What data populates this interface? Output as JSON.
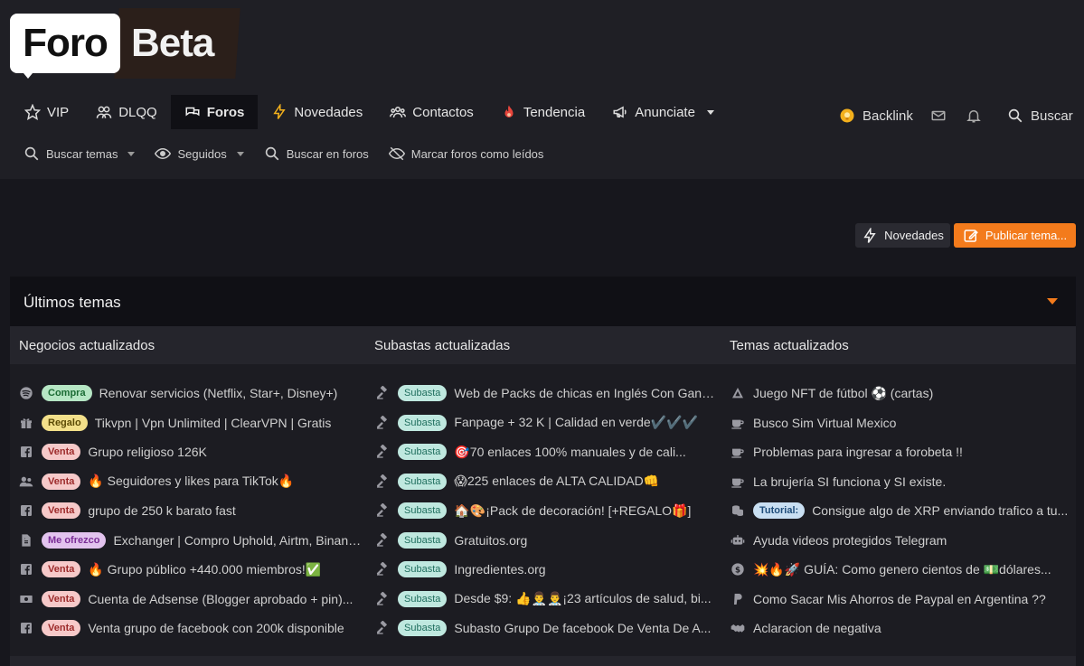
{
  "logo": {
    "part1": "Foro",
    "part2": "Beta"
  },
  "nav": {
    "vip": "VIP",
    "dlqq": "DLQQ",
    "foros": "Foros",
    "novedades": "Novedades",
    "contactos": "Contactos",
    "tendencia": "Tendencia",
    "anunciate": "Anunciate",
    "backlink": "Backlink",
    "buscar": "Buscar"
  },
  "subnav": {
    "buscar_temas": "Buscar temas",
    "seguidos": "Seguidos",
    "buscar_en_foros": "Buscar en foros",
    "marcar_leidos": "Marcar foros como leídos"
  },
  "actions": {
    "novedades": "Novedades",
    "publicar": "Publicar tema..."
  },
  "accent_color": "#f37b1c",
  "latest": {
    "title": "Últimos temas",
    "columns": {
      "negocios": "Negocios actualizados",
      "subastas": "Subastas actualizadas",
      "temas": "Temas actualizados"
    },
    "negocios": [
      {
        "icon": "spotify-icon",
        "badge": "Compra",
        "title": "Renovar servicios (Netflix, Star+, Disney+)"
      },
      {
        "icon": "gift-icon",
        "badge": "Regalo",
        "title": "Tikvpn | Vpn Unlimited | ClearVPN | Gratis"
      },
      {
        "icon": "facebook-icon",
        "badge": "Venta",
        "title": "Grupo religioso 126K"
      },
      {
        "icon": "users-icon",
        "badge": "Venta",
        "title": "🔥 Seguidores y likes para TikTok🔥"
      },
      {
        "icon": "facebook-icon",
        "badge": "Venta",
        "title": "grupo de 250 k barato fast"
      },
      {
        "icon": "document-icon",
        "badge": "Me ofrezco",
        "title": "Exchanger | Compro Uphold, Airtm, Binance..."
      },
      {
        "icon": "facebook-icon",
        "badge": "Venta",
        "title": "🔥 Grupo público +440.000 miembros!✅"
      },
      {
        "icon": "money-icon",
        "badge": "Venta",
        "title": "Cuenta de Adsense (Blogger aprobado + pin)..."
      },
      {
        "icon": "facebook-icon",
        "badge": "Venta",
        "title": "Venta grupo de facebook con 200k disponible"
      }
    ],
    "subastas": [
      {
        "badge": "Subasta",
        "title": "Web de Packs de chicas en Inglés Con Gana..."
      },
      {
        "badge": "Subasta",
        "title": "Fanpage + 32 K | Calidad en verde✔️✔️✔️"
      },
      {
        "badge": "Subasta",
        "title": "🎯70 enlaces 100% manuales y de cali..."
      },
      {
        "badge": "Subasta",
        "title": "😱225 enlaces de ALTA CALIDAD👊"
      },
      {
        "badge": "Subasta",
        "title": "🏠🎨¡Pack de decoración! [+REGALO🎁]"
      },
      {
        "badge": "Subasta",
        "title": "Gratuitos.org"
      },
      {
        "badge": "Subasta",
        "title": "Ingredientes.org"
      },
      {
        "badge": "Subasta",
        "title": "Desde $9: 👍👨‍⚕️👨‍⚕️¡23 artículos de salud, bi..."
      },
      {
        "badge": "Subasta",
        "title": "Subasto Grupo De facebook De Venta De A..."
      }
    ],
    "temas": [
      {
        "icon": "nft-icon",
        "badge": "",
        "title": "Juego NFT de fútbol ⚽ (cartas)"
      },
      {
        "icon": "coffee-icon",
        "badge": "",
        "title": "Busco Sim Virtual Mexico"
      },
      {
        "icon": "coffee-icon",
        "badge": "",
        "title": "Problemas para ingresar a forobeta !!"
      },
      {
        "icon": "coffee-icon",
        "badge": "",
        "title": "La brujería SI funciona y SI existe."
      },
      {
        "icon": "coins-icon",
        "badge": "Tutorial:",
        "title": "Consigue algo de XRP enviando trafico a tu..."
      },
      {
        "icon": "robot-icon",
        "badge": "",
        "title": "Ayuda videos protegidos Telegram"
      },
      {
        "icon": "dollar-icon",
        "badge": "",
        "title": "💥🔥🚀 GUÍA: Como genero cientos de 💵dólares..."
      },
      {
        "icon": "paypal-icon",
        "badge": "",
        "title": "Como Sacar Mis Ahorros de Paypal en Argentina ??"
      },
      {
        "icon": "handshake-icon",
        "badge": "",
        "title": "Aclaracion de negativa"
      }
    ]
  }
}
